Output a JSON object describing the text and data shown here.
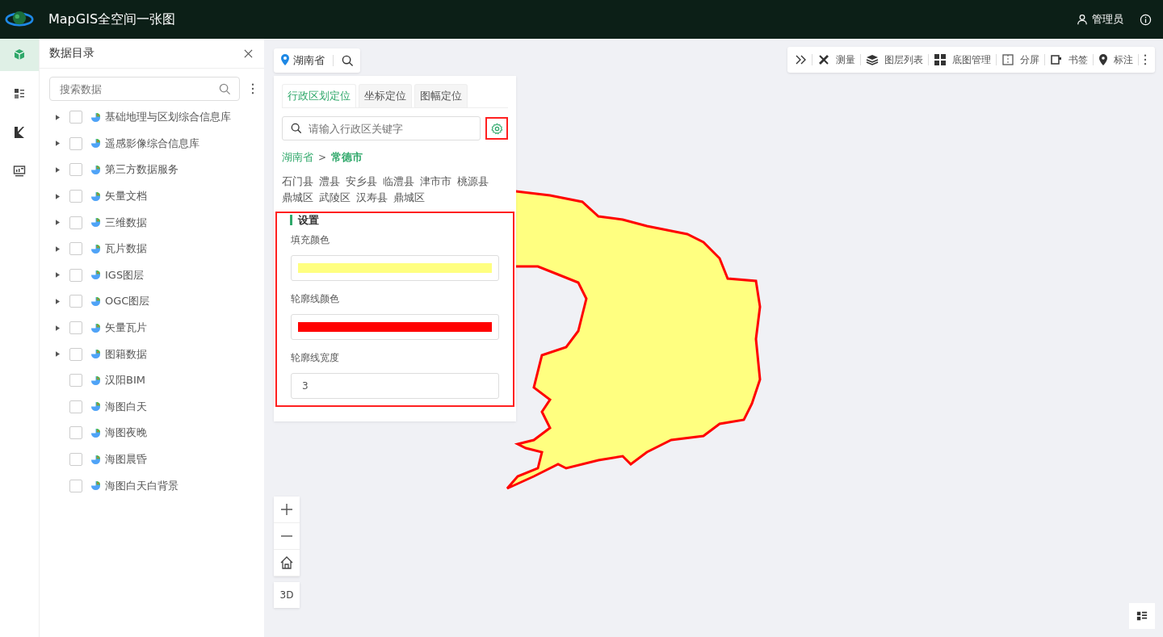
{
  "header": {
    "title": "MapGIS全空间一张图",
    "user": "管理员"
  },
  "rail": [
    {
      "selected": true
    },
    {
      "selected": false
    },
    {
      "selected": false
    },
    {
      "selected": false
    }
  ],
  "catalog": {
    "title": "数据目录",
    "search": {
      "placeholder": "搜索数据"
    },
    "items": [
      {
        "label": "基础地理与区划综合信息库",
        "has_children": true,
        "checked": false
      },
      {
        "label": "遥感影像综合信息库",
        "has_children": true,
        "checked": false
      },
      {
        "label": "第三方数据服务",
        "has_children": true,
        "checked": false
      },
      {
        "label": "矢量文档",
        "has_children": true,
        "checked": false
      },
      {
        "label": "三维数据",
        "has_children": true,
        "checked": false
      },
      {
        "label": "瓦片数据",
        "has_children": true,
        "checked": false
      },
      {
        "label": "IGS图层",
        "has_children": true,
        "checked": false
      },
      {
        "label": "OGC图层",
        "has_children": true,
        "checked": false
      },
      {
        "label": "矢量瓦片",
        "has_children": true,
        "checked": false
      },
      {
        "label": "图籍数据",
        "has_children": true,
        "checked": false
      },
      {
        "label": "汉阳BIM",
        "has_children": false,
        "checked": false
      },
      {
        "label": "海图白天",
        "has_children": false,
        "checked": false
      },
      {
        "label": "海图夜晚",
        "has_children": false,
        "checked": false
      },
      {
        "label": "海图晨昏",
        "has_children": false,
        "checked": false
      },
      {
        "label": "海图白天白背景",
        "has_children": false,
        "checked": false
      }
    ]
  },
  "location_chip": {
    "label": "湖南省"
  },
  "toolbar": [
    {
      "label": "测量"
    },
    {
      "label": "图层列表"
    },
    {
      "label": "底图管理"
    },
    {
      "label": "分屏"
    },
    {
      "label": "书签"
    },
    {
      "label": "标注"
    }
  ],
  "locate_panel": {
    "tabs": [
      {
        "label": "行政区划定位",
        "selected": true
      },
      {
        "label": "坐标定位",
        "selected": false
      },
      {
        "label": "图幅定位",
        "selected": false
      }
    ],
    "search": {
      "placeholder": "请输入行政区关键字"
    },
    "breadcrumb": {
      "items": [
        "湖南省",
        "常德市"
      ],
      "separator": ">"
    },
    "districts": [
      "石门县",
      "澧县",
      "安乡县",
      "临澧县",
      "津市市",
      "桃源县",
      "鼎城区",
      "武陵区",
      "汉寿县",
      "鼎城区"
    ],
    "settings": {
      "title": "设置",
      "fields": [
        {
          "kind": "color",
          "label": "填充颜色",
          "color": "#ffff80"
        },
        {
          "kind": "color",
          "label": "轮廓线颜色",
          "color": "#ff0000"
        },
        {
          "kind": "number",
          "label": "轮廓线宽度",
          "value": "3"
        }
      ]
    }
  },
  "map_controls": {
    "mode_button": "3D"
  }
}
